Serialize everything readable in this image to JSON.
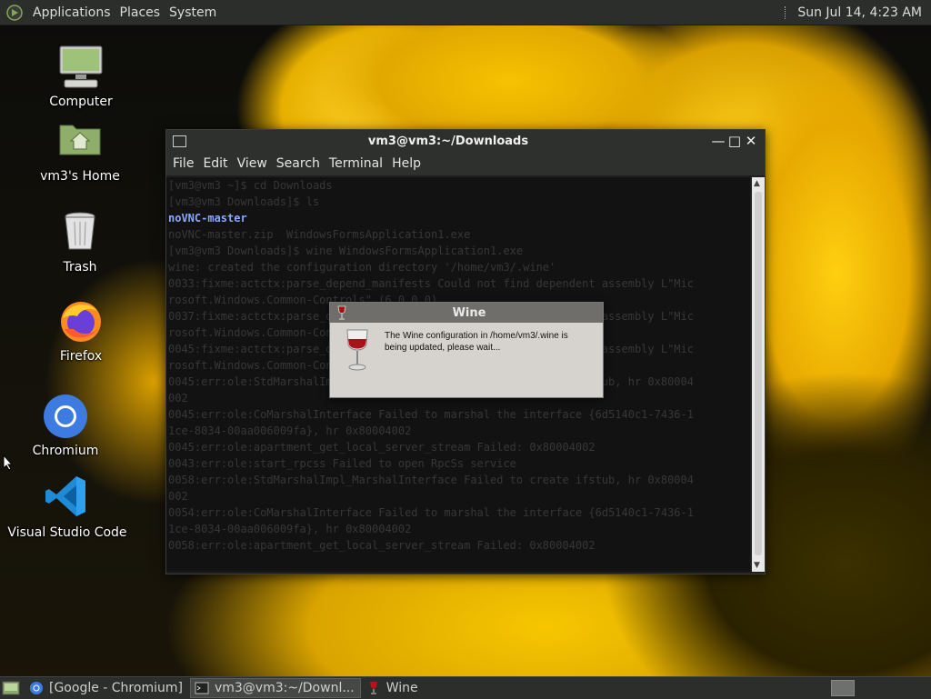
{
  "top_panel": {
    "menus": [
      "Applications",
      "Places",
      "System"
    ],
    "clock": "Sun Jul 14,  4:23 AM"
  },
  "desktop_icons": [
    {
      "label": "Computer",
      "icon": "computer-icon"
    },
    {
      "label": "vm3's Home",
      "icon": "home-folder-icon"
    },
    {
      "label": "Trash",
      "icon": "trash-icon"
    },
    {
      "label": "Firefox",
      "icon": "firefox-icon"
    },
    {
      "label": "Chromium",
      "icon": "chromium-icon"
    },
    {
      "label": "Visual Studio Code",
      "icon": "vscode-icon"
    }
  ],
  "terminal": {
    "title": "vm3@vm3:~/Downloads",
    "menu": [
      "File",
      "Edit",
      "View",
      "Search",
      "Terminal",
      "Help"
    ],
    "lines": [
      "[vm3@vm3 ~]$ cd Downloads",
      "[vm3@vm3 Downloads]$ ls",
      "noVNC-master",
      "noVNC-master.zip  WindowsFormsApplication1.exe",
      "[vm3@vm3 Downloads]$ wine WindowsFormsApplication1.exe",
      "wine: created the configuration directory '/home/vm3/.wine'",
      "0033:fixme:actctx:parse_depend_manifests Could not find dependent assembly L\"Mic",
      "rosoft.Windows.Common-Controls\" (6.0.0.0)",
      "0037:fixme:actctx:parse_depend_manifests Could not find dependent assembly L\"Mic",
      "rosoft.Windows.Common-Controls\" (6.0.0.0)",
      "0045:fixme:actctx:parse_depend_manifests Could not find dependent assembly L\"Mic",
      "rosoft.Windows.Common-Controls\" (6.0.0.0)",
      "0045:err:ole:StdMarshalImpl_MarshalInterface Failed to create ifstub, hr 0x80004",
      "002",
      "0045:err:ole:CoMarshalInterface Failed to marshal the interface {6d5140c1-7436-1",
      "1ce-8034-00aa006009fa}, hr 0x80004002",
      "0045:err:ole:apartment_get_local_server_stream Failed: 0x80004002",
      "0043:err:ole:start_rpcss Failed to open RpcSs service",
      "0058:err:ole:StdMarshalImpl_MarshalInterface Failed to create ifstub, hr 0x80004",
      "002",
      "0054:err:ole:CoMarshalInterface Failed to marshal the interface {6d5140c1-7436-1",
      "1ce-8034-00aa006009fa}, hr 0x80004002",
      "0058:err:ole:apartment_get_local_server_stream Failed: 0x80004002"
    ]
  },
  "wine_dialog": {
    "title": "Wine",
    "message": "The Wine configuration in /home/vm3/.wine is being updated, please wait..."
  },
  "bottom_panel": {
    "tasks": [
      {
        "label": "[Google - Chromium]",
        "icon": "chromium-icon",
        "active": false
      },
      {
        "label": "vm3@vm3:~/Downl...",
        "icon": "terminal-icon",
        "active": true
      },
      {
        "label": "Wine",
        "icon": "wine-icon",
        "active": false
      }
    ]
  },
  "colors": {
    "panel": "#2c2e2b",
    "terminal_bg": "#121212",
    "highlight_dir": "#8aa8ff",
    "dialog_bg": "#d6d3ce"
  }
}
